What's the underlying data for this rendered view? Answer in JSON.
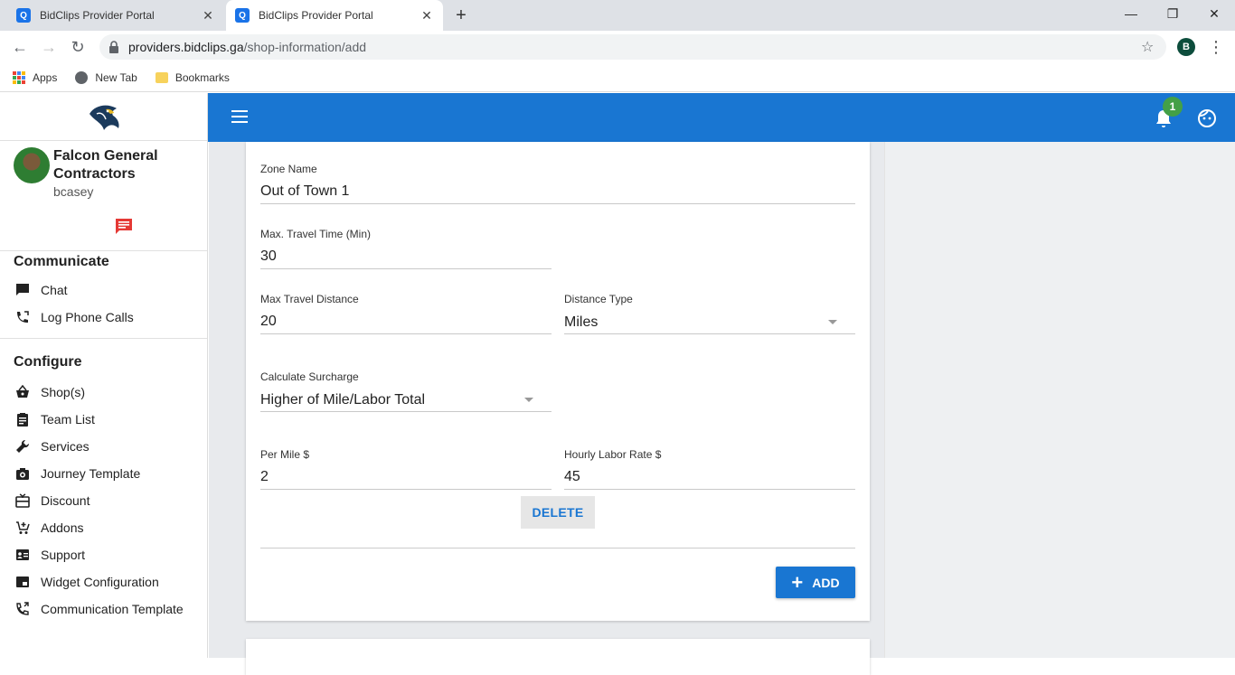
{
  "browser": {
    "tabs": [
      {
        "title": "BidClips Provider Portal",
        "active": false
      },
      {
        "title": "BidClips Provider Portal",
        "active": true
      }
    ],
    "url_host": "providers.bidclips.ga",
    "url_path": "/shop-information/add",
    "profile_initial": "B",
    "bookmarks": [
      {
        "label": "Apps",
        "icon": "apps-grid-icon"
      },
      {
        "label": "New Tab",
        "icon": "globe-icon"
      },
      {
        "label": "Bookmarks",
        "icon": "folder-icon"
      }
    ]
  },
  "sidebar": {
    "company": "Falcon General Contractors",
    "username": "bcasey",
    "sections": [
      {
        "title": "Communicate",
        "items": [
          {
            "label": "Chat",
            "icon": "chat-icon"
          },
          {
            "label": "Log Phone Calls",
            "icon": "phone-log-icon"
          }
        ]
      },
      {
        "title": "Configure",
        "items": [
          {
            "label": "Shop(s)",
            "icon": "shopping-basket-icon"
          },
          {
            "label": "Team List",
            "icon": "clipboard-icon"
          },
          {
            "label": "Services",
            "icon": "wrench-icon"
          },
          {
            "label": "Journey Template",
            "icon": "camera-icon"
          },
          {
            "label": "Discount",
            "icon": "gift-card-icon"
          },
          {
            "label": "Addons",
            "icon": "cart-plus-icon"
          },
          {
            "label": "Support",
            "icon": "contact-card-icon"
          },
          {
            "label": "Widget Configuration",
            "icon": "widget-icon"
          },
          {
            "label": "Communication Template",
            "icon": "phone-forward-icon"
          }
        ]
      }
    ]
  },
  "appbar": {
    "notification_count": "1"
  },
  "form": {
    "zone_name": {
      "label": "Zone Name",
      "value": "Out of Town 1"
    },
    "max_travel_time": {
      "label": "Max. Travel Time (Min)",
      "value": "30"
    },
    "max_travel_distance": {
      "label": "Max Travel Distance",
      "value": "20"
    },
    "distance_type": {
      "label": "Distance Type",
      "value": "Miles"
    },
    "calculate_surcharge": {
      "label": "Calculate Surcharge",
      "value": "Higher of Mile/Labor Total"
    },
    "per_mile": {
      "label": "Per Mile $",
      "value": "2"
    },
    "hourly_labor_rate": {
      "label": "Hourly Labor Rate $",
      "value": "45"
    },
    "delete_label": "DELETE",
    "add_label": "ADD"
  },
  "colors": {
    "primary": "#1976d2",
    "badge": "#43a047",
    "chat_red": "#e53935"
  }
}
